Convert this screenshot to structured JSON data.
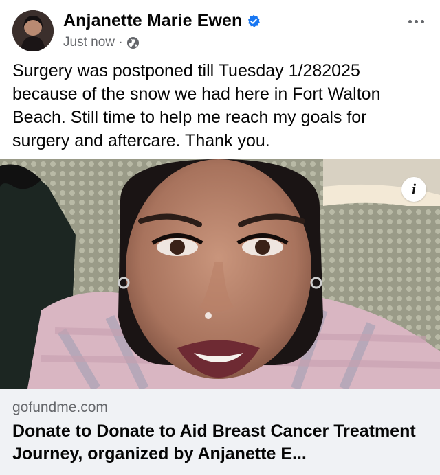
{
  "post": {
    "author_name": "Anjanette Marie Ewen",
    "verified": true,
    "timestamp": "Just now",
    "separator": "·",
    "audience_icon": "globe-icon",
    "more_icon": "more-dots-icon",
    "text": "Surgery was postponed till Tuesday 1/282025 because of the snow we had here in Fort Walton Beach. Still time to help me reach my goals for surgery and aftercare. Thank you.",
    "media_info_label": "i"
  },
  "link_preview": {
    "domain": "gofundme.com",
    "title": "Donate to Donate to Aid Breast Cancer Treatment Journey, organized by Anjanette E..."
  },
  "colors": {
    "verified_blue": "#1877f2",
    "secondary_text": "#65676b",
    "link_card_bg": "#f0f2f5"
  }
}
